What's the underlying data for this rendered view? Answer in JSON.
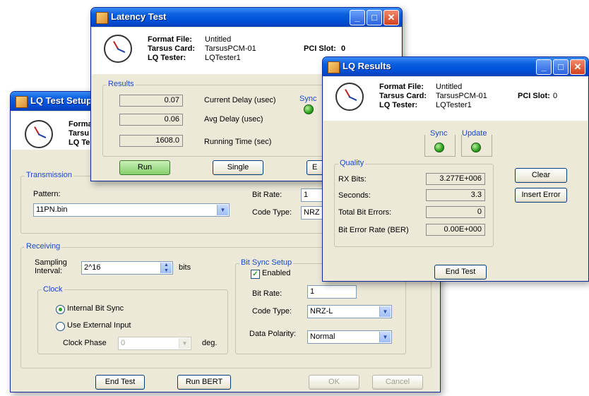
{
  "setup": {
    "title": "LQ Test Setup",
    "header": {
      "format_file_label": "Forma",
      "tarsus_card_label": "Tarsu",
      "lq_tester_label": "LQ Te"
    },
    "transmission": {
      "group": "Transmission",
      "pattern_label": "Pattern:",
      "pattern_value": "11PN.bin",
      "bit_rate_label": "Bit Rate:",
      "bit_rate_value": "1",
      "code_type_label": "Code Type:",
      "code_type_value": "NRZ"
    },
    "receiving": {
      "group": "Receiving",
      "sampling_label_1": "Sampling",
      "sampling_label_2": "Interval:",
      "sampling_value": "2^16",
      "bits_label": "bits",
      "clock_group": "Clock",
      "internal_bit_sync": "Internal Bit Sync",
      "use_external_input": "Use External Input",
      "clock_phase_label": "Clock Phase",
      "clock_phase_value": "0",
      "deg_label": "deg."
    },
    "bit_sync": {
      "group": "Bit Sync Setup",
      "enabled_label": "Enabled",
      "bit_rate_label": "Bit Rate:",
      "bit_rate_value": "1",
      "code_type_label": "Code Type:",
      "code_type_value": "NRZ-L",
      "data_polarity_label": "Data Polarity:",
      "data_polarity_value": "Normal"
    },
    "buttons": {
      "end_test": "End Test",
      "run_bert": "Run BERT",
      "ok": "OK",
      "cancel": "Cancel"
    }
  },
  "latency": {
    "title": "Latency Test",
    "format_file_label": "Format File:",
    "format_file_value": "Untitled",
    "tarsus_card_label": "Tarsus Card:",
    "tarsus_card_value": "TarsusPCM-01",
    "lq_tester_label": "LQ Tester:",
    "lq_tester_value": "LQTester1",
    "pci_slot_label": "PCI Slot:",
    "pci_slot_value": "0",
    "results_group": "Results",
    "current_delay_value": "0.07",
    "current_delay_label": "Current Delay (usec)",
    "avg_delay_value": "0.06",
    "avg_delay_label": "Avg Delay (usec)",
    "running_time_value": "1608.0",
    "running_time_label": "Running Time (sec)",
    "sync_label": "Sync",
    "run_button": "Run",
    "single_button": "Single",
    "partial_button": "E"
  },
  "lq_results": {
    "title": "LQ Results",
    "format_file_label": "Format File:",
    "format_file_value": "Untitled",
    "tarsus_card_label": "Tarsus Card:",
    "tarsus_card_value": "TarsusPCM-01",
    "lq_tester_label": "LQ Tester:",
    "lq_tester_value": "LQTester1",
    "pci_slot_label": "PCI Slot:",
    "pci_slot_value": "0",
    "sync_label": "Sync",
    "update_label": "Update",
    "quality_group": "Quality",
    "rx_bits_label": "RX Bits:",
    "rx_bits_value": "3.277E+006",
    "seconds_label": "Seconds:",
    "seconds_value": "3.3",
    "total_bit_errors_label": "Total Bit Errors:",
    "total_bit_errors_value": "0",
    "ber_label": "Bit Error Rate (BER)",
    "ber_value": "0.00E+000",
    "clear_button": "Clear",
    "insert_error_button": "Insert Error",
    "end_test_button": "End Test"
  },
  "colors": {
    "titlebar": "#0050d8",
    "window_bg": "#ece9d8",
    "group_title": "#1a48c4",
    "led_green": "#2ea11e"
  }
}
